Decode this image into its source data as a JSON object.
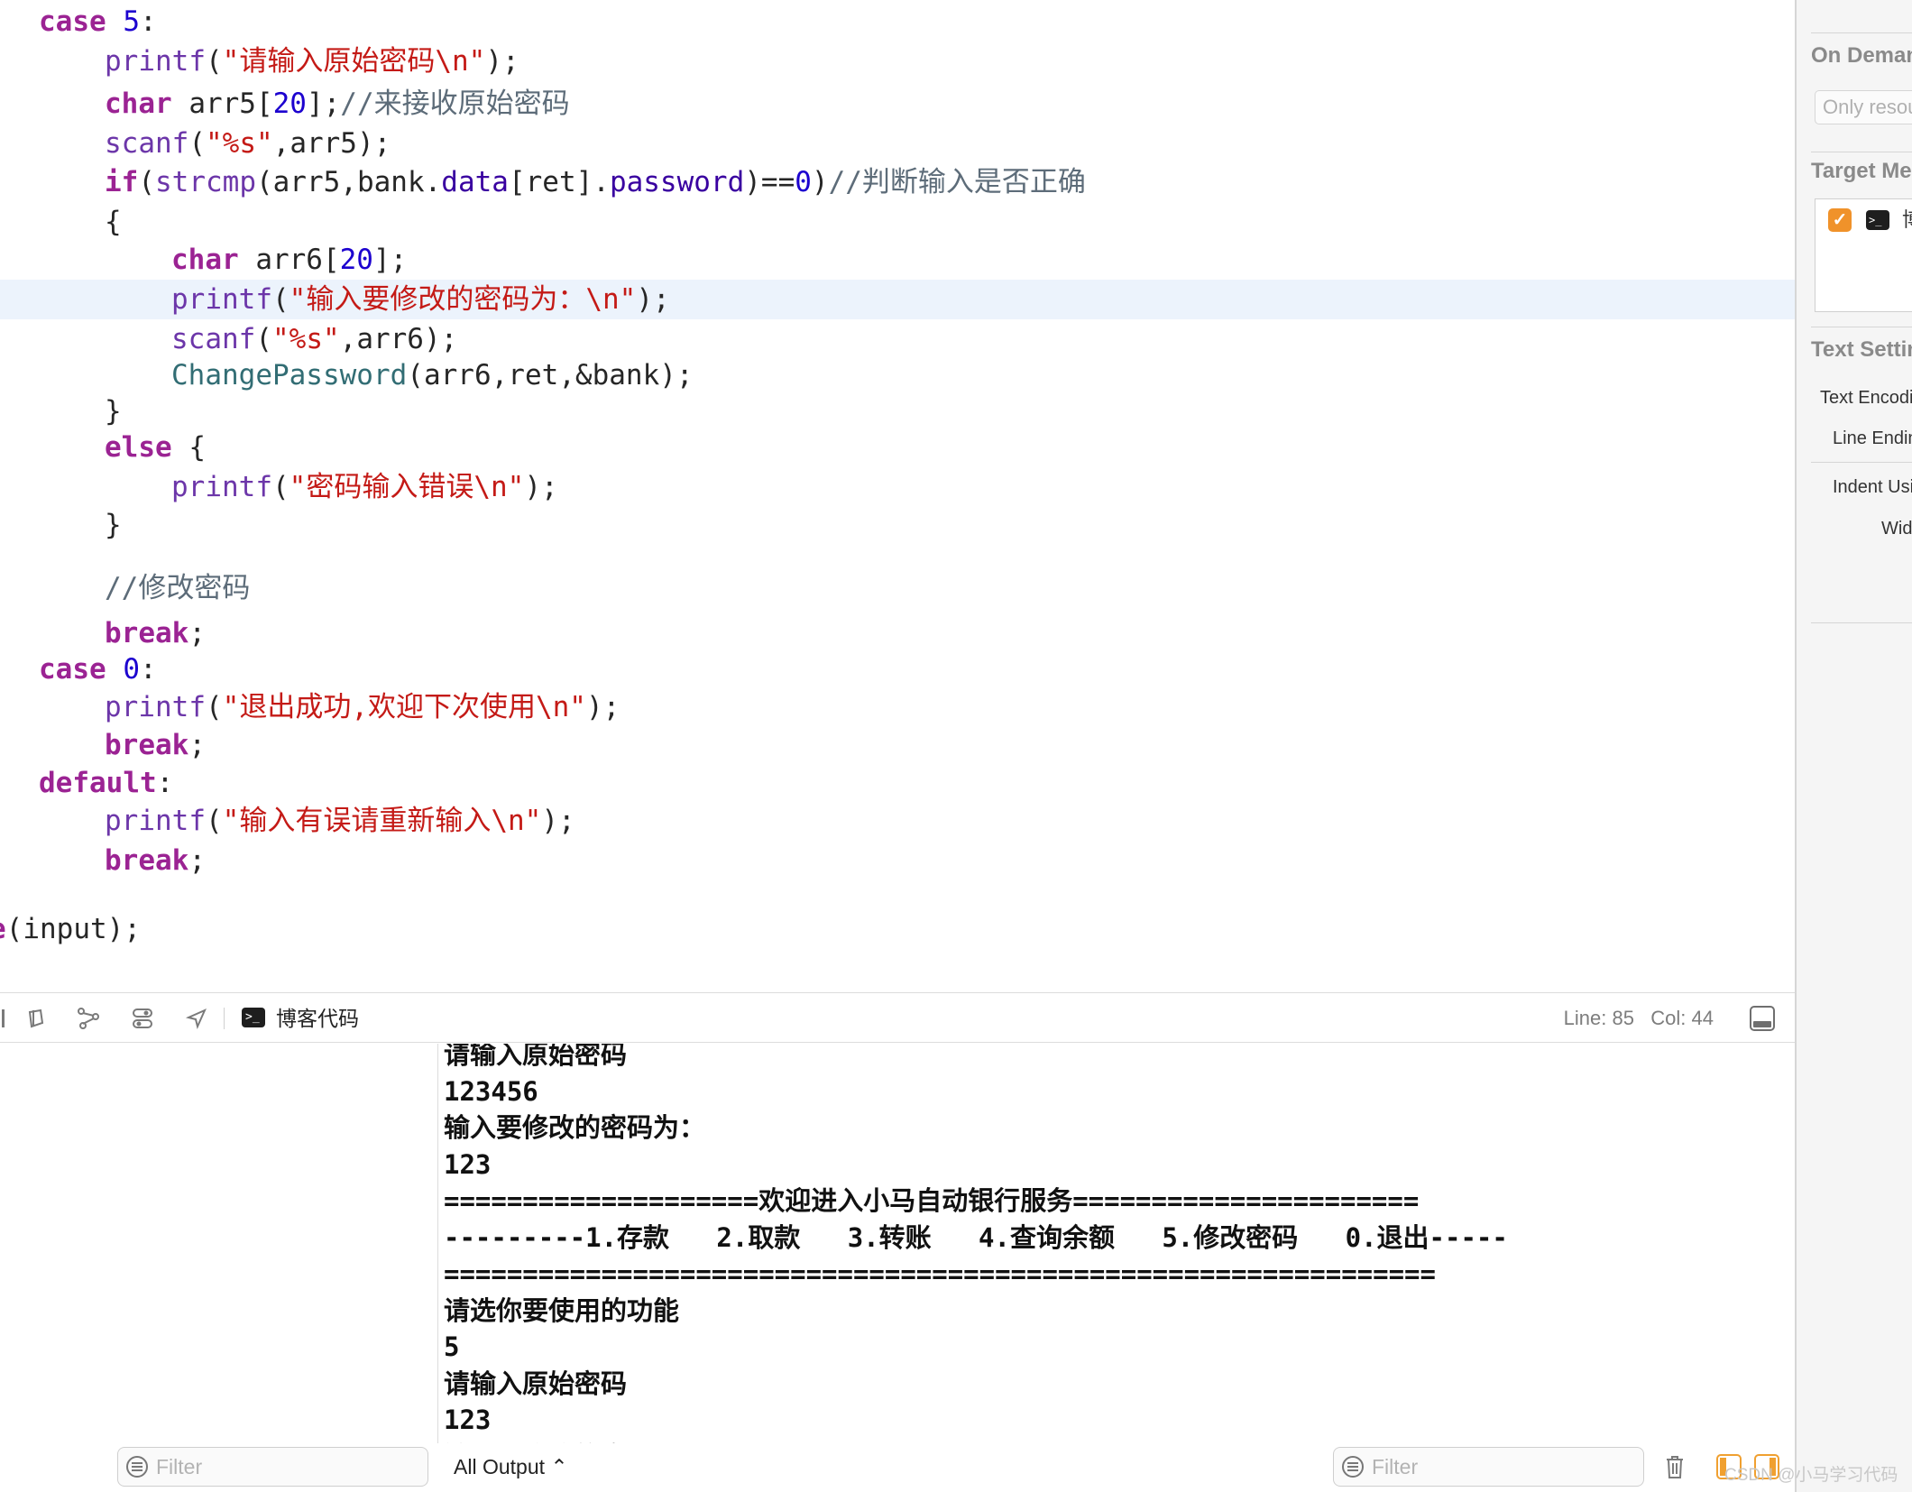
{
  "editor": {
    "lines": [
      {
        "id": "l1",
        "parts": [
          {
            "c": "kw",
            "t": "case"
          },
          {
            "t": " "
          },
          {
            "c": "num",
            "t": "5"
          },
          {
            "t": ":"
          }
        ]
      },
      {
        "id": "l2",
        "parts": [
          {
            "c": "fn",
            "t": "printf"
          },
          {
            "t": "("
          },
          {
            "c": "str",
            "t": "\"请输入原始密码\\n\""
          },
          {
            "t": ");"
          }
        ]
      },
      {
        "id": "l3",
        "parts": [
          {
            "c": "kw",
            "t": "char"
          },
          {
            "t": " arr5["
          },
          {
            "c": "num",
            "t": "20"
          },
          {
            "t": "];"
          },
          {
            "c": "cmt",
            "t": "//来接收原始密码"
          }
        ]
      },
      {
        "id": "l4",
        "parts": [
          {
            "c": "fn",
            "t": "scanf"
          },
          {
            "t": "("
          },
          {
            "c": "str",
            "t": "\"%s\""
          },
          {
            "t": ",arr5);"
          }
        ]
      },
      {
        "id": "l5",
        "parts": [
          {
            "c": "kw",
            "t": "if"
          },
          {
            "t": "("
          },
          {
            "c": "fn",
            "t": "strcmp"
          },
          {
            "t": "(arr5,bank."
          },
          {
            "c": "mem",
            "t": "data"
          },
          {
            "t": "[ret]."
          },
          {
            "c": "mem",
            "t": "password"
          },
          {
            "t": ")=="
          },
          {
            "c": "num",
            "t": "0"
          },
          {
            "t": ")"
          },
          {
            "c": "cmt",
            "t": "//判断输入是否正确"
          }
        ]
      },
      {
        "id": "l6",
        "parts": [
          {
            "t": "{"
          }
        ]
      },
      {
        "id": "l7",
        "parts": [
          {
            "c": "kw",
            "t": "char"
          },
          {
            "t": " arr6["
          },
          {
            "c": "num",
            "t": "20"
          },
          {
            "t": "];"
          }
        ]
      },
      {
        "id": "l8",
        "parts": [
          {
            "c": "fn",
            "t": "printf"
          },
          {
            "t": "("
          },
          {
            "c": "str",
            "t": "\"输入要修改的密码为：\\n\""
          },
          {
            "t": ");"
          }
        ]
      },
      {
        "id": "l9",
        "parts": [
          {
            "c": "fn",
            "t": "scanf"
          },
          {
            "t": "("
          },
          {
            "c": "str",
            "t": "\"%s\""
          },
          {
            "t": ",arr6);"
          }
        ]
      },
      {
        "id": "l10",
        "parts": [
          {
            "c": "pp",
            "t": "ChangePassword"
          },
          {
            "t": "(arr6,ret,&bank);"
          }
        ]
      },
      {
        "id": "l11",
        "parts": [
          {
            "t": "}"
          }
        ]
      },
      {
        "id": "l12",
        "parts": [
          {
            "c": "kw",
            "t": "else"
          },
          {
            "t": " {"
          }
        ]
      },
      {
        "id": "l13",
        "parts": [
          {
            "c": "fn",
            "t": "printf"
          },
          {
            "t": "("
          },
          {
            "c": "str",
            "t": "\"密码输入错误\\n\""
          },
          {
            "t": ");"
          }
        ]
      },
      {
        "id": "l14",
        "parts": [
          {
            "t": "}"
          }
        ]
      },
      {
        "id": "l15",
        "parts": [
          {
            "c": "cmt",
            "t": "//修改密码"
          }
        ]
      },
      {
        "id": "l16",
        "parts": [
          {
            "c": "kw",
            "t": "break"
          },
          {
            "t": ";"
          }
        ]
      },
      {
        "id": "l17",
        "parts": [
          {
            "c": "kw",
            "t": "case"
          },
          {
            "t": " "
          },
          {
            "c": "num",
            "t": "0"
          },
          {
            "t": ":"
          }
        ]
      },
      {
        "id": "l18",
        "parts": [
          {
            "c": "fn",
            "t": "printf"
          },
          {
            "t": "("
          },
          {
            "c": "str",
            "t": "\"退出成功,欢迎下次使用\\n\""
          },
          {
            "t": ");"
          }
        ]
      },
      {
        "id": "l19",
        "parts": [
          {
            "c": "kw",
            "t": "break"
          },
          {
            "t": ";"
          }
        ]
      },
      {
        "id": "l20",
        "parts": [
          {
            "c": "kw",
            "t": "default"
          },
          {
            "t": ":"
          }
        ]
      },
      {
        "id": "l21",
        "parts": [
          {
            "c": "fn",
            "t": "printf"
          },
          {
            "t": "("
          },
          {
            "c": "str",
            "t": "\"输入有误请重新输入\\n\""
          },
          {
            "t": ");"
          }
        ]
      },
      {
        "id": "l22",
        "parts": [
          {
            "c": "kw",
            "t": "break"
          },
          {
            "t": ";"
          }
        ]
      },
      {
        "id": "l23",
        "parts": [
          {
            "c": "kw",
            "t": "e"
          },
          {
            "t": "(input);"
          }
        ]
      }
    ]
  },
  "debug_bar": {
    "scheme_name": "博客代码",
    "line_label": "Line: 85",
    "col_label": "Col: 44"
  },
  "console": {
    "lines": [
      "请输入原始密码",
      "123456",
      "输入要修改的密码为：",
      "123",
      "====================欢迎进入小马自动银行服务======================",
      "---------1.存款   2.取款   3.转账   4.查询余额   5.修改密码   0.退出-----",
      "===============================================================",
      "请选你要使用的功能",
      "5",
      "请输入原始密码",
      "123",
      "输入要修改的密码为："
    ]
  },
  "bottom_bar": {
    "left_filter_placeholder": "Filter",
    "output_select": "All Output ⌃",
    "right_filter_placeholder": "Filter"
  },
  "inspector": {
    "on_demand_heading": "On Demand Resource Tags",
    "on_demand_placeholder": "Only resources with these tags",
    "target_membership_heading": "Target Membership",
    "target_name": "博客代码",
    "text_settings_heading": "Text Settings",
    "text_encoding_label": "Text Encoding",
    "line_endings_label": "Line Endings",
    "indent_using_label": "Indent Using",
    "widths_label": "Widths"
  },
  "watermark": "CSDN @小马学习代码",
  "colors": {
    "keyword": "#9b2393",
    "number": "#1c00cf",
    "string": "#c41a16",
    "comment": "#5d6c79",
    "function": "#6c36a9",
    "current_line": "#ecf3fc",
    "accent_orange": "#f0922a"
  }
}
